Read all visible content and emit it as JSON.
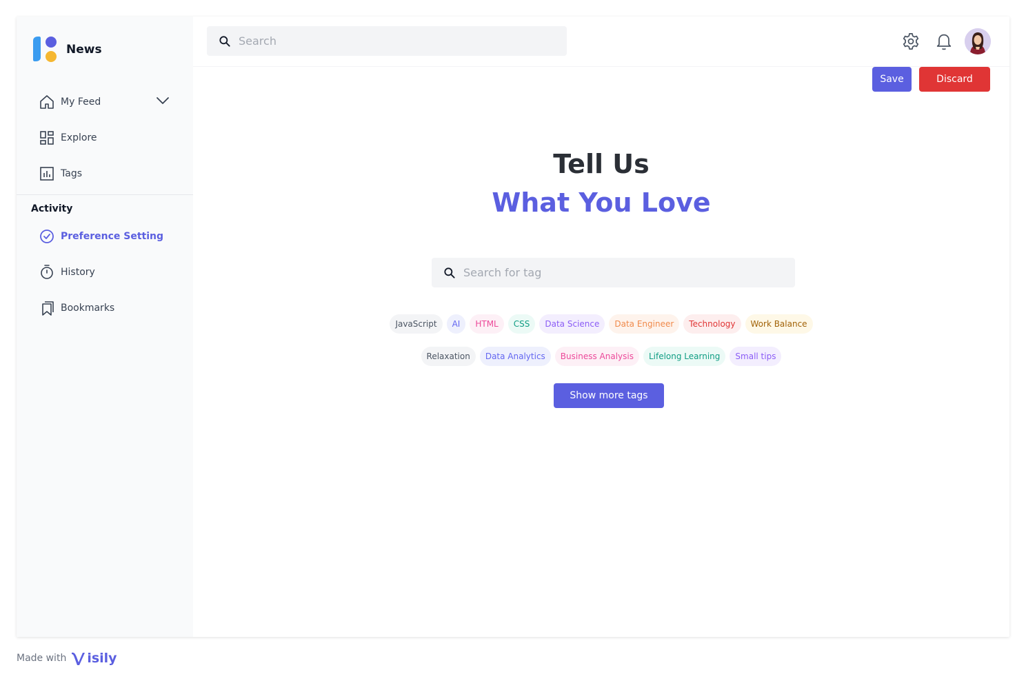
{
  "brand": {
    "title": "News"
  },
  "nav": {
    "my_feed": "My Feed",
    "explore": "Explore",
    "tags": "Tags"
  },
  "activity": {
    "section_label": "Activity",
    "preference": "Preference Setting",
    "history": "History",
    "bookmarks": "Bookmarks"
  },
  "topbar": {
    "search_placeholder": "Search"
  },
  "actions": {
    "save": "Save",
    "discard": "Discard"
  },
  "hero": {
    "line1": "Tell Us",
    "line2": "What You Love"
  },
  "tag_search": {
    "placeholder": "Search for tag"
  },
  "tags_row1": [
    {
      "label": "JavaScript",
      "color": "#4b5563",
      "bg": "#f3f4f6"
    },
    {
      "label": "AI",
      "color": "#6366f1",
      "bg": "#eef0fd"
    },
    {
      "label": "HTML",
      "color": "#ec4899",
      "bg": "#fdf0f6"
    },
    {
      "label": "CSS",
      "color": "#0f9d83",
      "bg": "#ecfaf6"
    },
    {
      "label": "Data Science",
      "color": "#8b5cf6",
      "bg": "#f3eefe"
    },
    {
      "label": "Data Engineer",
      "color": "#f08a4b",
      "bg": "#fef3ec"
    },
    {
      "label": "Technology",
      "color": "#e03535",
      "bg": "#fdeeee"
    },
    {
      "label": "Work Balance",
      "color": "#a16207",
      "bg": "#fef8e7"
    }
  ],
  "tags_row2": [
    {
      "label": "Relaxation",
      "color": "#4b5563",
      "bg": "#f3f4f6"
    },
    {
      "label": "Data Analytics",
      "color": "#6366f1",
      "bg": "#eef0fd"
    },
    {
      "label": "Business Analysis",
      "color": "#ec4899",
      "bg": "#fdf0f6"
    },
    {
      "label": "Lifelong Learning",
      "color": "#0f9d83",
      "bg": "#ecfaf6"
    },
    {
      "label": "Small tips",
      "color": "#8b5cf6",
      "bg": "#f3eefe"
    }
  ],
  "show_more": "Show more tags",
  "footer": {
    "made_with": "Made with",
    "brand": "isily"
  },
  "colors": {
    "accent": "#5b5fe0",
    "danger": "#e03535"
  }
}
